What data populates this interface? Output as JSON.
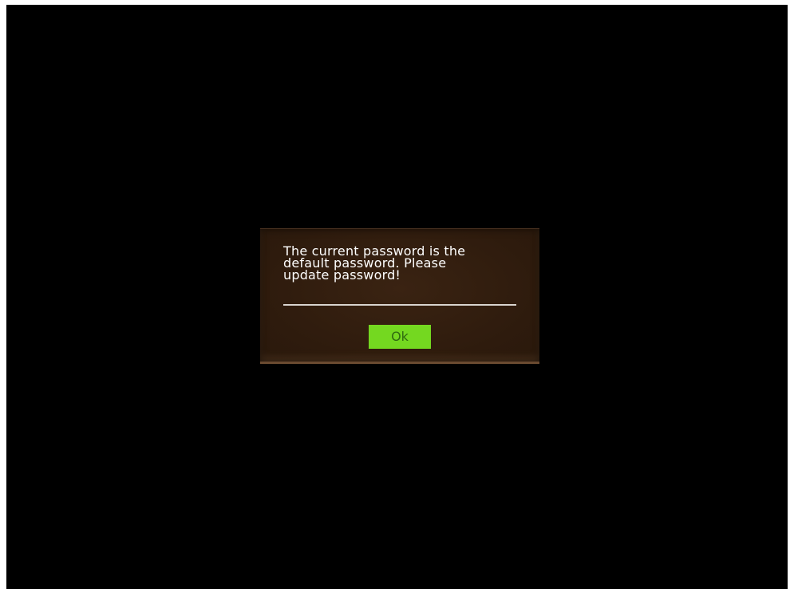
{
  "dialog": {
    "message": "The current password is the\ndefault password. Please\nupdate password!",
    "ok_label": "Ok"
  },
  "colors": {
    "background": "#000000",
    "dialog": "#2e1b0d",
    "divider": "#d9d4cf",
    "ok_button": "#74d820",
    "ok_text": "#2f6a10"
  }
}
